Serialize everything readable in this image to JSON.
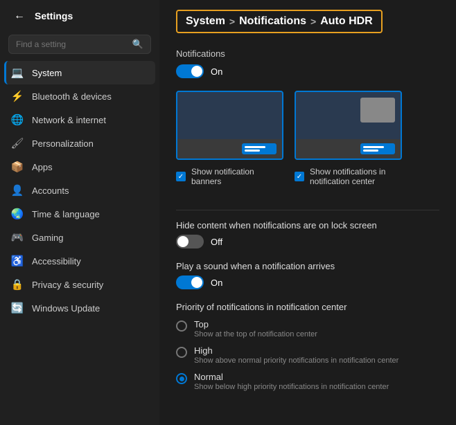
{
  "sidebar": {
    "title": "Settings",
    "search_placeholder": "Find a setting",
    "items": [
      {
        "id": "system",
        "label": "System",
        "icon": "🖥",
        "icon_type": "blue",
        "active": true
      },
      {
        "id": "bluetooth",
        "label": "Bluetooth & devices",
        "icon": "⚡",
        "icon_type": "blue",
        "active": false
      },
      {
        "id": "network",
        "label": "Network & internet",
        "icon": "🌐",
        "icon_type": "teal",
        "active": false
      },
      {
        "id": "personalization",
        "label": "Personalization",
        "icon": "🖌",
        "icon_type": "gray",
        "active": false
      },
      {
        "id": "apps",
        "label": "Apps",
        "icon": "📦",
        "icon_type": "gray",
        "active": false
      },
      {
        "id": "accounts",
        "label": "Accounts",
        "icon": "👤",
        "icon_type": "gray",
        "active": false
      },
      {
        "id": "time",
        "label": "Time & language",
        "icon": "🌍",
        "icon_type": "green",
        "active": false
      },
      {
        "id": "gaming",
        "label": "Gaming",
        "icon": "🎮",
        "icon_type": "gray",
        "active": false
      },
      {
        "id": "accessibility",
        "label": "Accessibility",
        "icon": "♿",
        "icon_type": "blue",
        "active": false
      },
      {
        "id": "privacy",
        "label": "Privacy & security",
        "icon": "🔒",
        "icon_type": "gray",
        "active": false
      },
      {
        "id": "windows",
        "label": "Windows Update",
        "icon": "🔄",
        "icon_type": "blue",
        "active": false
      }
    ]
  },
  "breadcrumb": {
    "parts": [
      "System",
      "Notifications",
      "Auto HDR"
    ],
    "separators": [
      ">",
      ">"
    ]
  },
  "content": {
    "notifications_section": "Notifications",
    "notifications_toggle": "On",
    "notifications_on": true,
    "banners_label": "Show notification banners",
    "notification_center_label": "Show notifications in notification center",
    "lock_screen_label": "Hide content when notifications are on lock screen",
    "lock_screen_toggle": "Off",
    "lock_screen_on": false,
    "sound_label": "Play a sound when a notification arrives",
    "sound_toggle": "On",
    "sound_on": true,
    "priority_label": "Priority of notifications in notification center",
    "radio_options": [
      {
        "id": "top",
        "label": "Top",
        "desc": "Show at the top of notification center",
        "selected": false
      },
      {
        "id": "high",
        "label": "High",
        "desc": "Show above normal priority notifications in notification center",
        "selected": false
      },
      {
        "id": "normal",
        "label": "Normal",
        "desc": "Show below high priority notifications in notification center",
        "selected": true
      }
    ]
  }
}
